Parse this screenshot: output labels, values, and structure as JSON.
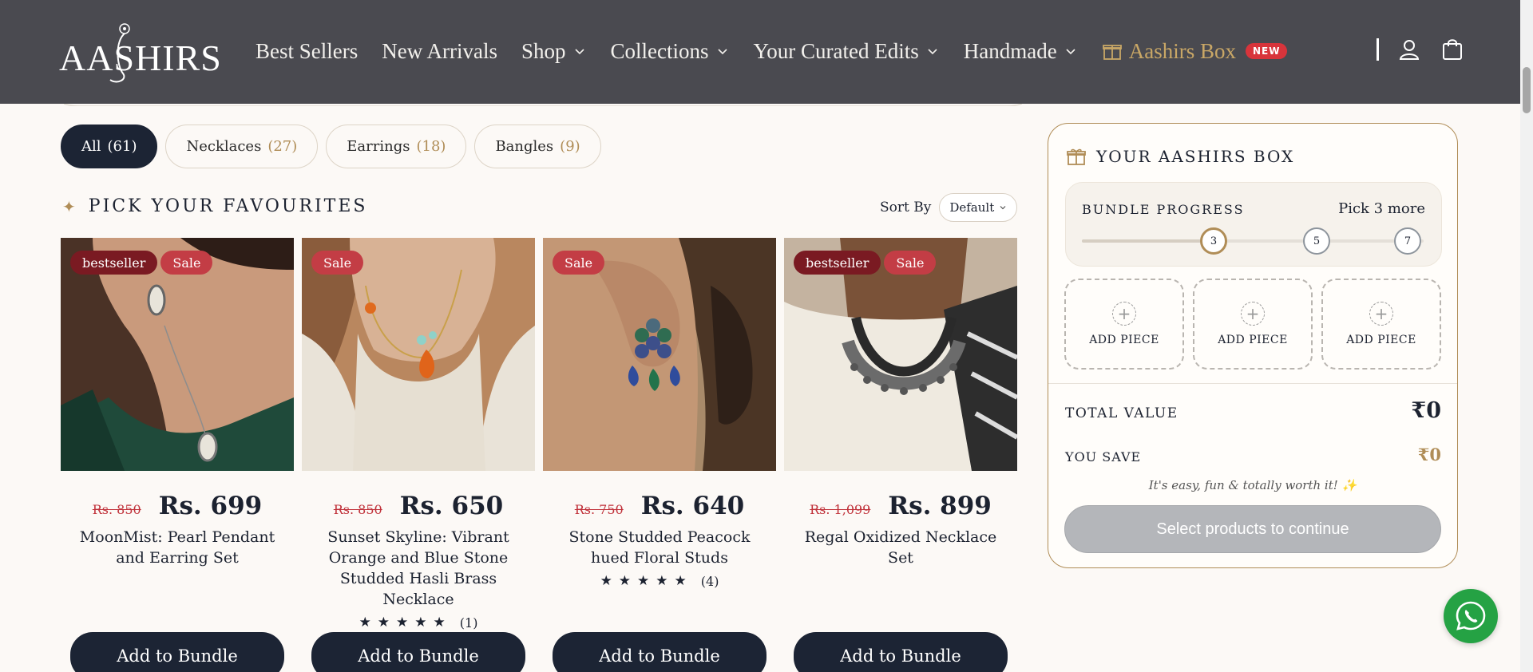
{
  "header": {
    "logo": "AASHIRS",
    "nav": [
      {
        "label": "Best Sellers",
        "has_menu": false
      },
      {
        "label": "New Arrivals",
        "has_menu": false
      },
      {
        "label": "Shop",
        "has_menu": true
      },
      {
        "label": "Collections",
        "has_menu": true
      },
      {
        "label": "Your Curated Edits",
        "has_menu": true
      },
      {
        "label": "Handmade",
        "has_menu": true
      }
    ],
    "box_link": {
      "label": "Aashirs Box",
      "badge": "NEW"
    },
    "icons": [
      "search-cursor-icon",
      "account-icon",
      "cart-icon"
    ],
    "bg_color": "#4a4a50",
    "accent_color": "#c9a766"
  },
  "filters": [
    {
      "label": "All",
      "count": "(61)",
      "active": true
    },
    {
      "label": "Necklaces",
      "count": "(27)",
      "active": false
    },
    {
      "label": "Earrings",
      "count": "(18)",
      "active": false
    },
    {
      "label": "Bangles",
      "count": "(9)",
      "active": false
    }
  ],
  "section": {
    "icon": "sparkle-icon",
    "title": "PICK YOUR FAVOURITES",
    "sort_label": "Sort By",
    "sort_value": "Default"
  },
  "products": [
    {
      "badges": [
        "bestseller",
        "Sale"
      ],
      "old_price": "Rs. 850",
      "price": "Rs. 699",
      "name": "MoonMist: Pearl Pendant and Earring Set",
      "stars": "",
      "reviews": "",
      "button": "Add to Bundle"
    },
    {
      "badges": [
        "Sale"
      ],
      "old_price": "Rs. 850",
      "price": "Rs. 650",
      "name": "Sunset Skyline: Vibrant Orange and Blue Stone Studded Hasli Brass Necklace",
      "stars": "★★★★★",
      "reviews": "(1)",
      "button": "Add to Bundle"
    },
    {
      "badges": [
        "Sale"
      ],
      "old_price": "Rs. 750",
      "price": "Rs. 640",
      "name": "Stone Studded Peacock hued Floral Studs",
      "stars": "★★★★★",
      "reviews": "(4)",
      "button": "Add to Bundle"
    },
    {
      "badges": [
        "bestseller",
        "Sale"
      ],
      "old_price": "Rs. 1,099",
      "price": "Rs. 899",
      "name": "Regal Oxidized Necklace Set",
      "stars": "",
      "reviews": "",
      "button": "Add to Bundle"
    }
  ],
  "bundle": {
    "icon": "gift-icon",
    "title": "YOUR AASHIRS BOX",
    "progress_label": "BUNDLE PROGRESS",
    "progress_hint": "Pick 3 more",
    "steps": [
      "3",
      "5",
      "7"
    ],
    "current_step": "3",
    "slots": [
      "ADD PIECE",
      "ADD PIECE",
      "ADD PIECE"
    ],
    "total_label": "TOTAL VALUE",
    "total_value": "₹0",
    "save_label": "YOU SAVE",
    "save_value": "₹0",
    "note": "It's easy, fun & totally worth it! ✨",
    "cta": "Select products to continue"
  },
  "whatsapp": {
    "icon": "whatsapp-icon"
  }
}
